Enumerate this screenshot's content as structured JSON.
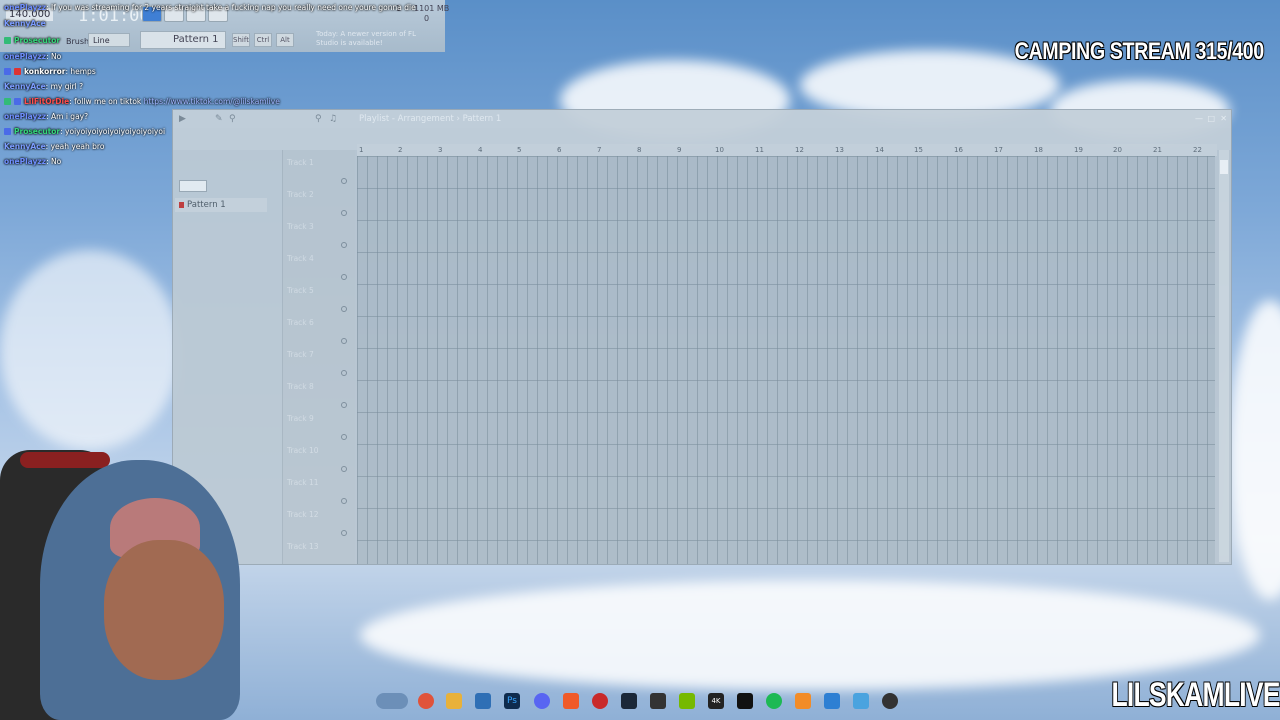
{
  "overlay": {
    "camping_title": "CAMPING STREAM 315/400",
    "channel_name": "LILSKAMLIVE"
  },
  "fl_studio": {
    "tempo": "140.000",
    "time": "1:01:00",
    "cpu": "1",
    "ram": "1101 MB",
    "zero": "0",
    "brush_label": "Brush",
    "snap": "Line",
    "pattern": "Pattern 1",
    "mods": [
      "Shift",
      "Ctrl",
      "Alt"
    ],
    "news": "Today: A newer version of FL Studio is available!"
  },
  "chat": [
    {
      "user": "onePlayzz",
      "text": "If you was streaming for 2 years straight take a fucking nap you really need one youre gonna die",
      "color": "#6f8fff"
    },
    {
      "user": "KennyAce",
      "text": "",
      "color": "#7b9cff"
    },
    {
      "user": "Prosecutor",
      "text": "",
      "color": "#34d67a"
    },
    {
      "user": "onePlayzz",
      "text": ": No",
      "color": "#6f8fff"
    },
    {
      "user": "konkorror",
      "text": ": hemps",
      "color": "#ffffff"
    },
    {
      "user": "KennyAce",
      "text": ": my girl ?",
      "color": "#7b9cff"
    },
    {
      "user": "LilFitOrDie",
      "text": ": follw me on tiktok",
      "link": "https://www.tiktok.com/@lilskamlive",
      "color": "#ff4d4d"
    },
    {
      "user": "onePlayzz",
      "text": ": Am i gay?",
      "color": "#6f8fff"
    },
    {
      "user": "Prosecutor",
      "text": ": yoiyoiyoiyoiyoiyoiyoiyoiyoi",
      "color": "#34d67a"
    },
    {
      "user": "KennyAce",
      "text": ": yeah yeah bro",
      "color": "#7b9cff"
    },
    {
      "user": "onePlayzz",
      "text": ": No",
      "color": "#6f8fff"
    }
  ],
  "playlist": {
    "title": "Playlist - Arrangement › Pattern 1",
    "pattern_item": "Pattern 1",
    "tracks": [
      "Track 1",
      "Track 2",
      "Track 3",
      "Track 4",
      "Track 5",
      "Track 6",
      "Track 7",
      "Track 8",
      "Track 9",
      "Track 10",
      "Track 11",
      "Track 12",
      "Track 13"
    ],
    "ruler": [
      "1",
      "2",
      "3",
      "4",
      "5",
      "6",
      "7",
      "8",
      "9",
      "10",
      "11",
      "12",
      "13",
      "14",
      "15",
      "16",
      "17",
      "18",
      "19",
      "20",
      "21",
      "22"
    ]
  },
  "taskbar": {
    "icons": [
      "browser-icon",
      "chrome-icon",
      "folder-icon",
      "store-icon",
      "photoshop-icon",
      "discord-icon",
      "brave-icon",
      "opera-icon",
      "steam-icon",
      "app-icon",
      "nvidia-icon",
      "4k-icon",
      "capcut-icon",
      "spotify-icon",
      "fl-studio-icon",
      "photos-icon",
      "notepad-icon",
      "media-icon"
    ],
    "labels": [
      "",
      "",
      "",
      "",
      "Ps",
      "",
      "",
      "",
      "",
      "",
      "",
      "4K",
      "",
      "",
      "",
      "",
      "",
      ""
    ]
  }
}
